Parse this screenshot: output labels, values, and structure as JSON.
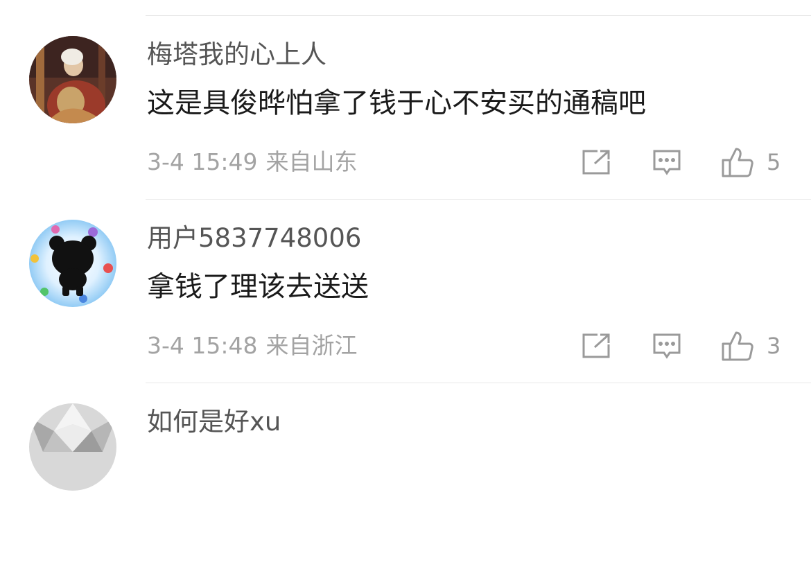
{
  "comments": [
    {
      "username": "梅塔我的心上人",
      "text": "这是具俊晔怕拿了钱于心不安买的通稿吧",
      "time": "3-4 15:49",
      "location": "来自山东",
      "likes": "5"
    },
    {
      "username": "用户5837748006",
      "text": "拿钱了理该去送送",
      "time": "3-4 15:48",
      "location": "来自浙江",
      "likes": "3"
    },
    {
      "username": "如何是好xu"
    }
  ],
  "icons": {
    "share": "share-icon",
    "reply": "comment-icon",
    "like": "thumbs-up-icon"
  },
  "colors": {
    "username": "#555555",
    "text": "#1a1a1a",
    "meta": "#a3a3a3",
    "icon": "#9a9a9a",
    "divider": "#e7e7e7"
  }
}
